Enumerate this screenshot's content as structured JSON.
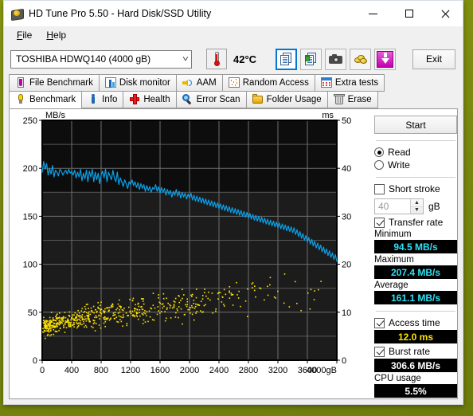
{
  "window": {
    "title": "HD Tune Pro 5.50 - Hard Disk/SSD Utility",
    "icon": "harddisk-icon",
    "minimize": "minimize-icon",
    "maximize": "maximize-icon",
    "close": "close-icon"
  },
  "menu": {
    "items": [
      "File",
      "Help"
    ]
  },
  "toolbar": {
    "drive": "TOSHIBA HDWQ140 (4000 gB)",
    "drive_chevron": "chevron-down-icon",
    "temperature": "42°C",
    "temperature_icon": "thermometer-icon",
    "buttons": [
      {
        "name": "copy-report-button",
        "icon": "document-copy-icon",
        "selected": true
      },
      {
        "name": "save-report-button",
        "icon": "document-save-icon",
        "selected": false
      },
      {
        "name": "screenshot-button",
        "icon": "camera-icon",
        "selected": false
      },
      {
        "name": "options-button",
        "icon": "coins-icon",
        "selected": false
      },
      {
        "name": "download-button",
        "icon": "download-arrow-icon",
        "selected": false
      }
    ],
    "exit_label": "Exit"
  },
  "tabs": {
    "row1": [
      {
        "label": "File Benchmark",
        "icon": "file-benchmark-icon",
        "active": false
      },
      {
        "label": "Disk monitor",
        "icon": "disk-monitor-icon",
        "active": false
      },
      {
        "label": "AAM",
        "icon": "aam-speaker-icon",
        "active": false
      },
      {
        "label": "Random Access",
        "icon": "random-access-icon",
        "active": false
      },
      {
        "label": "Extra tests",
        "icon": "extra-tests-icon",
        "active": false
      }
    ],
    "row2": [
      {
        "label": "Benchmark",
        "icon": "benchmark-icon",
        "active": true
      },
      {
        "label": "Info",
        "icon": "info-icon",
        "active": false
      },
      {
        "label": "Health",
        "icon": "health-cross-icon",
        "active": false
      },
      {
        "label": "Error Scan",
        "icon": "error-scan-magnifier-icon",
        "active": false
      },
      {
        "label": "Folder Usage",
        "icon": "folder-usage-icon",
        "active": false
      },
      {
        "label": "Erase",
        "icon": "erase-trash-icon",
        "active": false
      }
    ]
  },
  "panel": {
    "start_label": "Start",
    "mode": {
      "read_label": "Read",
      "write_label": "Write",
      "selected": "Read"
    },
    "short_stroke": {
      "label": "Short stroke",
      "checked": false,
      "value": "40",
      "unit": "gB"
    },
    "transfer_rate": {
      "label": "Transfer rate",
      "checked": true
    },
    "minimum": {
      "label": "Minimum",
      "value": "94.5 MB/s"
    },
    "maximum": {
      "label": "Maximum",
      "value": "207.4 MB/s"
    },
    "average": {
      "label": "Average",
      "value": "161.1 MB/s"
    },
    "access_time": {
      "label": "Access time",
      "checked": true,
      "value": "12.0 ms"
    },
    "burst_rate": {
      "label": "Burst rate",
      "checked": true,
      "value": "306.6 MB/s"
    },
    "cpu_usage": {
      "label": "CPU usage",
      "value": "5.5%"
    }
  },
  "chart_data": {
    "type": "line",
    "title": "",
    "xlabel": "gB",
    "ylabel": "MB/s",
    "y2label": "ms",
    "xlim": [
      0,
      4000
    ],
    "ylim": [
      0,
      250
    ],
    "y2lim": [
      0,
      50
    ],
    "xticks": [
      0,
      400,
      800,
      1200,
      1600,
      2000,
      2400,
      2800,
      3200,
      3600,
      4000
    ],
    "yticks": [
      0,
      50,
      100,
      150,
      200,
      250
    ],
    "y2ticks": [
      0,
      10,
      20,
      30,
      40,
      50
    ],
    "grid": true,
    "plot_bg": "#1c1c1c",
    "legend": "none",
    "series": [
      {
        "name": "Transfer rate",
        "axis": "left",
        "color": "#0aa0e8",
        "type": "line",
        "x": [
          0,
          20,
          40,
          60,
          80,
          100,
          120,
          140,
          160,
          180,
          200,
          220,
          240,
          260,
          280,
          300,
          320,
          340,
          360,
          380,
          400,
          420,
          440,
          460,
          480,
          500,
          520,
          540,
          560,
          580,
          600,
          620,
          640,
          660,
          680,
          700,
          720,
          740,
          760,
          780,
          800,
          820,
          840,
          860,
          880,
          900,
          920,
          940,
          960,
          980,
          1000,
          1020,
          1040,
          1060,
          1080,
          1100,
          1120,
          1140,
          1160,
          1180,
          1200,
          1220,
          1240,
          1260,
          1280,
          1300,
          1320,
          1340,
          1360,
          1380,
          1400,
          1420,
          1440,
          1460,
          1480,
          1500,
          1520,
          1540,
          1560,
          1580,
          1600,
          1620,
          1640,
          1660,
          1680,
          1700,
          1720,
          1740,
          1760,
          1780,
          1800,
          1820,
          1840,
          1860,
          1880,
          1900,
          1920,
          1940,
          1960,
          1980,
          2000,
          2020,
          2040,
          2060,
          2080,
          2100,
          2120,
          2140,
          2160,
          2180,
          2200,
          2220,
          2240,
          2260,
          2280,
          2300,
          2320,
          2340,
          2360,
          2380,
          2400,
          2420,
          2440,
          2460,
          2480,
          2500,
          2520,
          2540,
          2560,
          2580,
          2600,
          2620,
          2640,
          2660,
          2680,
          2700,
          2720,
          2740,
          2760,
          2780,
          2800,
          2820,
          2840,
          2860,
          2880,
          2900,
          2920,
          2940,
          2960,
          2980,
          3000,
          3020,
          3040,
          3060,
          3080,
          3100,
          3120,
          3140,
          3160,
          3180,
          3200,
          3220,
          3240,
          3260,
          3280,
          3300,
          3320,
          3340,
          3360,
          3380,
          3400,
          3420,
          3440,
          3460,
          3480,
          3500,
          3520,
          3540,
          3560,
          3580,
          3600,
          3620,
          3640,
          3660,
          3680,
          3700,
          3720,
          3740,
          3760,
          3780,
          3800,
          3820,
          3840,
          3860,
          3880,
          3900,
          3920,
          3940,
          3960,
          3980,
          4000
        ],
        "y": [
          196,
          207,
          199,
          205,
          193,
          200,
          194,
          203,
          191,
          198,
          196,
          192,
          199,
          197,
          193,
          196,
          198,
          194,
          199,
          195,
          197,
          193,
          198,
          190,
          196,
          191,
          199,
          187,
          195,
          189,
          198,
          186,
          197,
          191,
          199,
          186,
          196,
          188,
          195,
          184,
          193,
          197,
          190,
          199,
          186,
          196,
          192,
          188,
          198,
          190,
          186,
          196,
          183,
          190,
          186,
          181,
          188,
          184,
          179,
          186,
          183,
          188,
          182,
          186,
          180,
          185,
          178,
          184,
          179,
          183,
          176,
          182,
          177,
          181,
          175,
          180,
          178,
          183,
          176,
          181,
          174,
          180,
          175,
          179,
          172,
          178,
          173,
          177,
          170,
          176,
          172,
          178,
          171,
          176,
          169,
          175,
          170,
          174,
          168,
          173,
          169,
          174,
          167,
          172,
          166,
          171,
          165,
          170,
          164,
          169,
          163,
          168,
          162,
          167,
          161,
          166,
          160,
          165,
          159,
          164,
          158,
          163,
          157,
          162,
          156,
          161,
          155,
          160,
          154,
          159,
          153,
          158,
          152,
          157,
          151,
          156,
          150,
          155,
          149,
          154,
          148,
          153,
          147,
          152,
          146,
          151,
          145,
          150,
          144,
          149,
          143,
          148,
          142,
          147,
          141,
          146,
          140,
          145,
          139,
          144,
          138,
          143,
          137,
          142,
          136,
          141,
          135,
          140,
          134,
          139,
          133,
          138,
          131,
          136,
          129,
          134,
          127,
          132,
          125,
          130,
          123,
          128,
          121,
          126,
          119,
          124,
          117,
          122,
          115,
          120,
          113,
          118,
          111,
          116,
          109,
          114,
          107,
          112,
          105,
          110,
          103,
          108,
          101,
          106,
          99
        ]
      },
      {
        "name": "Access time",
        "axis": "right",
        "color": "#ffe400",
        "type": "scatter",
        "point_count": 620,
        "trend_start_ms": 7.0,
        "trend_end_ms": 15.5,
        "spread_ms": 5.5
      }
    ]
  }
}
